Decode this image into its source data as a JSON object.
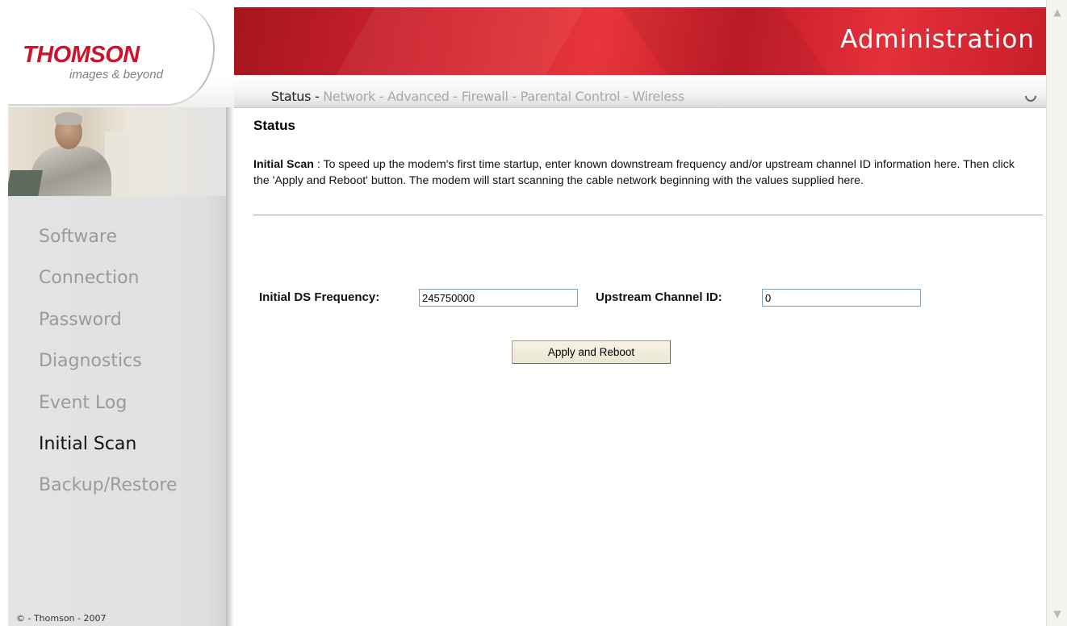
{
  "header": {
    "logo_word": "THOMSON",
    "logo_tagline": "images & beyond",
    "title": "Administration"
  },
  "topnav": {
    "items": [
      {
        "label": "Status",
        "sep": " - ",
        "active": true
      },
      {
        "label": "Network",
        "sep": " - ",
        "active": false
      },
      {
        "label": "Advanced",
        "sep": " - ",
        "active": false
      },
      {
        "label": "Firewall",
        "sep": " - ",
        "active": false
      },
      {
        "label": "Parental Control",
        "sep": " - ",
        "active": false
      },
      {
        "label": "Wireless",
        "sep": "",
        "active": false
      }
    ],
    "spinner_icon": "spinner-icon"
  },
  "sidebar": {
    "items": [
      {
        "label": "Software",
        "active": false
      },
      {
        "label": "Connection",
        "active": false
      },
      {
        "label": "Password",
        "active": false
      },
      {
        "label": "Diagnostics",
        "active": false
      },
      {
        "label": "Event Log",
        "active": false
      },
      {
        "label": "Initial Scan",
        "active": true
      },
      {
        "label": "Backup/Restore",
        "active": false
      }
    ],
    "copyright": "© - Thomson - 2007"
  },
  "main": {
    "title": "Status",
    "description_lead": "Initial Scan",
    "description_sep": " : ",
    "description_text": "To speed up the modem's first time startup, enter known downstream frequency and/or upstream channel ID information here. Then click the 'Apply and Reboot' button. The modem will start scanning the cable network beginning with the values supplied here.",
    "form": {
      "ds_label": "Initial DS Frequency:",
      "ds_value": "245750000",
      "upstream_label": "Upstream Channel ID:",
      "upstream_value": "0"
    },
    "apply_button": "Apply and Reboot"
  },
  "colors": {
    "brand_red": "#d0112b",
    "banner_red": "#d2232e",
    "menu_inactive": "#9a9a9a",
    "menu_active": "#111111"
  }
}
